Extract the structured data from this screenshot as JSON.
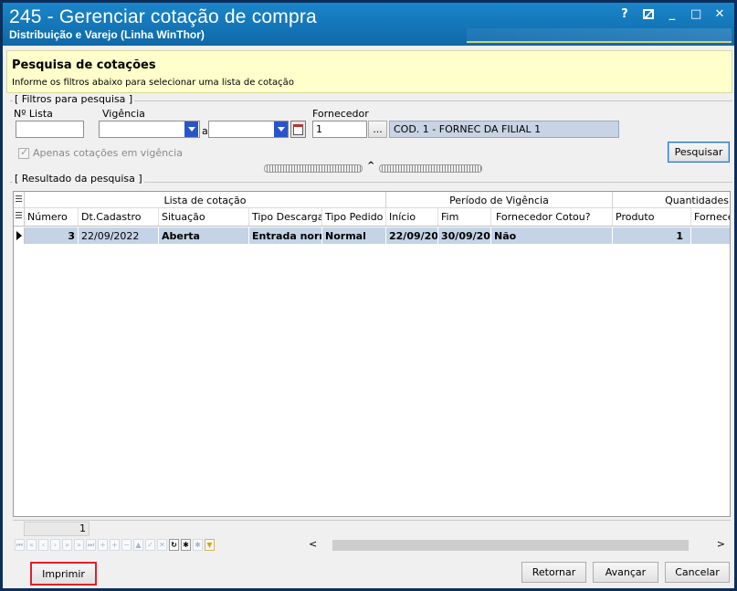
{
  "window": {
    "title": "245 - Gerenciar cotação de compra",
    "subtitle": "Distribuição e Varejo (Linha WinThor)",
    "controls": {
      "help": "?",
      "minimize": "_",
      "maximize": "□",
      "close": "✕"
    }
  },
  "header": {
    "heading": "Pesquisa de cotações",
    "description": "Informe os filtros abaixo para selecionar uma lista de cotação"
  },
  "filters": {
    "group_label": "[ Filtros para pesquisa ]",
    "num_lista_label": "Nº Lista",
    "num_lista_value": "",
    "vigencia_label": "Vigência",
    "vigencia_from": "",
    "vigencia_sep": "a",
    "vigencia_to": "",
    "fornecedor_label": "Fornecedor",
    "fornecedor_code": "1",
    "fornecedor_lookup": "...",
    "fornecedor_name": "COD. 1 - FORNEC DA FILIAL 1",
    "only_active_label": "Apenas cotações em vigência",
    "only_active_checked": true,
    "search_button": "Pesquisar"
  },
  "results": {
    "group_label": "[ Resultado da pesquisa ]",
    "bands": [
      "Lista de cotação",
      "Período de Vigência",
      "Quantidades"
    ],
    "columns": [
      "Número",
      "Dt.Cadastro",
      "Situação",
      "Tipo Descarga",
      "Tipo Pedido",
      "Início",
      "Fim",
      "Fornecedor Cotou?",
      "Produto",
      "Fornecedor"
    ],
    "rows": [
      {
        "numero": "3",
        "dt_cadastro": "22/09/2022",
        "situacao": "Aberta",
        "tipo_descarga": "Entrada norm",
        "tipo_pedido": "Normal",
        "inicio": "22/09/20",
        "fim": "30/09/20",
        "fornecedor_cotou": "Não",
        "produto": "1",
        "fornecedor": ""
      }
    ],
    "record_count": "1"
  },
  "footer": {
    "print": "Imprimir",
    "back": "Retornar",
    "next": "Avançar",
    "cancel": "Cancelar"
  },
  "colors": {
    "title_bar": "#1376b8",
    "info_panel": "#ffffcc",
    "selected_row": "#c4d3e6",
    "highlight": "#e0202a"
  }
}
